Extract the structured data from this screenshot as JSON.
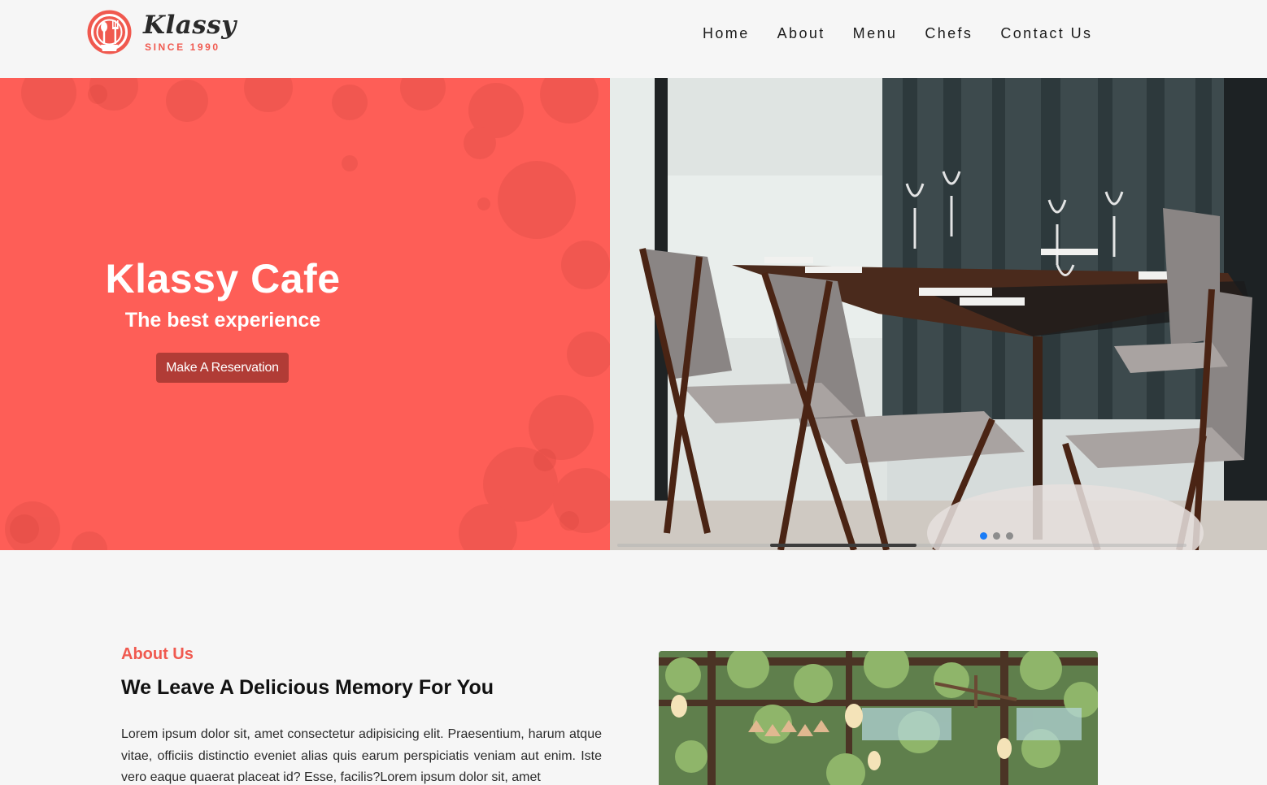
{
  "brand": {
    "name": "Klassy",
    "tagline": "SINCE 1990",
    "accent": "#f0594f"
  },
  "nav": {
    "items": [
      "Home",
      "About",
      "Menu",
      "Chefs",
      "Contact Us"
    ]
  },
  "hero": {
    "title": "Klassy Cafe",
    "subtitle": "The best experience",
    "button_label": "Make A Reservation",
    "panel_color": "#fe5e57",
    "button_color": "#b13c36",
    "carousel": {
      "slide_count": 3,
      "active_index": 0
    }
  },
  "about": {
    "kicker": "About Us",
    "heading": "We Leave A Delicious Memory For You",
    "body": "Lorem ipsum dolor sit, amet consectetur adipisicing elit. Praesentium, harum atque vitae, officiis distinctio eveniet alias quis earum perspiciatis veniam aut enim. Iste vero eaque quaerat placeat id? Esse, facilis?Lorem ipsum dolor sit, amet"
  }
}
